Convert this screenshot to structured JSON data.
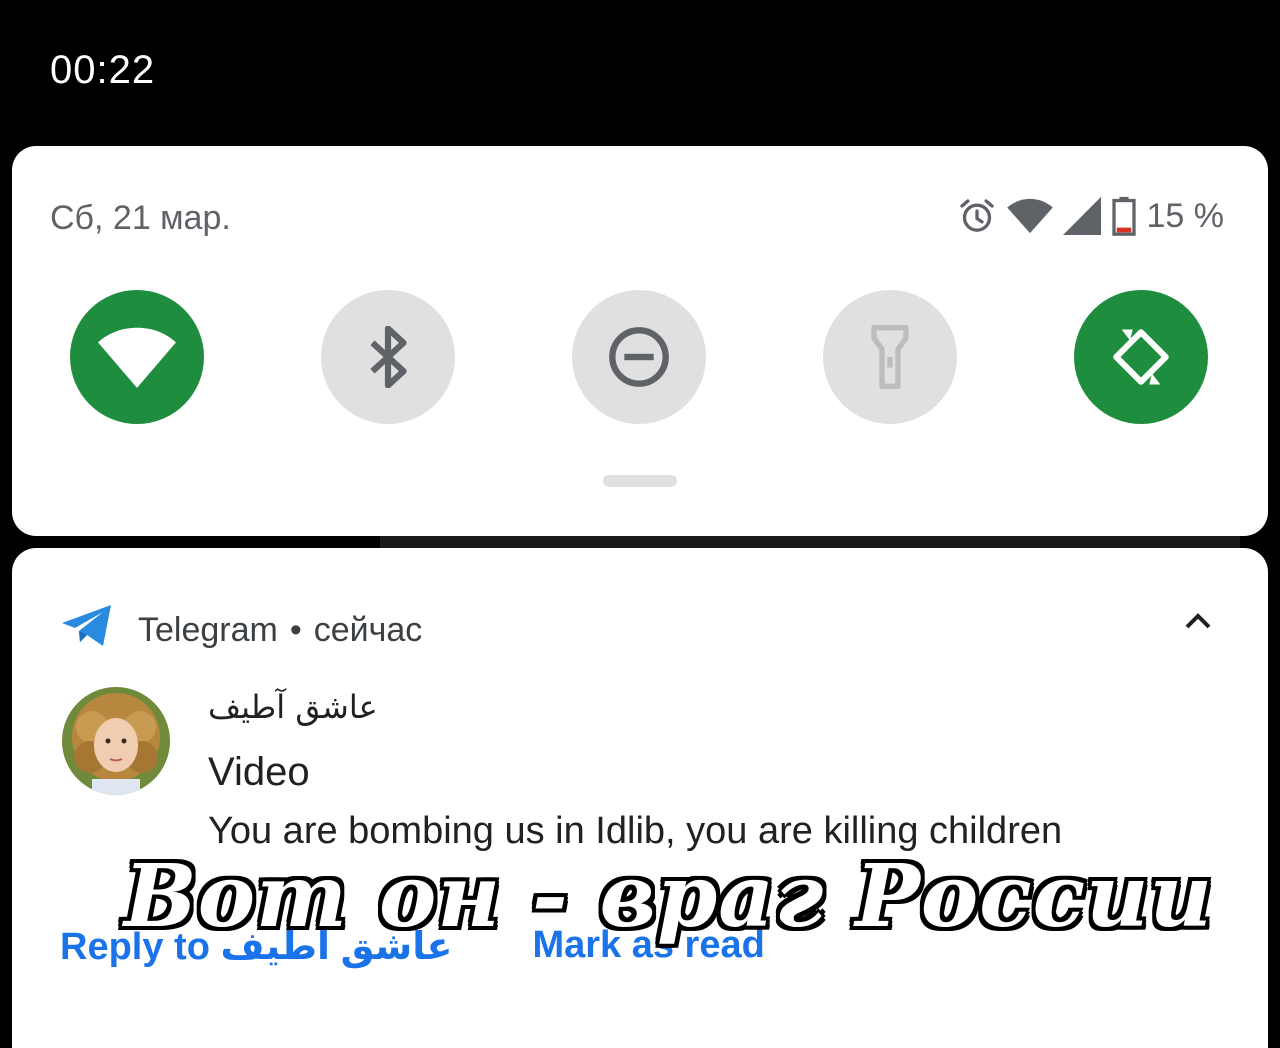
{
  "status_bar": {
    "time": "00:22"
  },
  "quick_settings": {
    "date": "Сб, 21 мар.",
    "battery_percent": "15 %",
    "battery_level": 0.15,
    "status_icons": [
      "alarm-icon",
      "wifi-signal-icon",
      "cellular-signal-icon",
      "battery-icon"
    ],
    "tiles": [
      {
        "name": "wifi",
        "icon": "wifi-icon",
        "active": true
      },
      {
        "name": "bluetooth",
        "icon": "bluetooth-icon",
        "active": false
      },
      {
        "name": "do-not-disturb",
        "icon": "do-not-disturb-icon",
        "active": false
      },
      {
        "name": "flashlight",
        "icon": "flashlight-icon",
        "active": false
      },
      {
        "name": "auto-rotate",
        "icon": "auto-rotate-icon",
        "active": true
      }
    ],
    "accent_color": "#1e8e3e",
    "inactive_color": "#e0e0e0"
  },
  "notification": {
    "app_name": "Telegram",
    "separator": "•",
    "time": "сейчас",
    "sender": "عاشق آطيف",
    "title": "Video",
    "message": "You are bombing us in Idlib, you are killing children",
    "actions": {
      "reply": "Reply to عاشق آطيف",
      "mark_read": "Mark as read"
    },
    "action_color": "#1a73e8"
  },
  "overlay": {
    "caption": "Вот он - враг России"
  }
}
